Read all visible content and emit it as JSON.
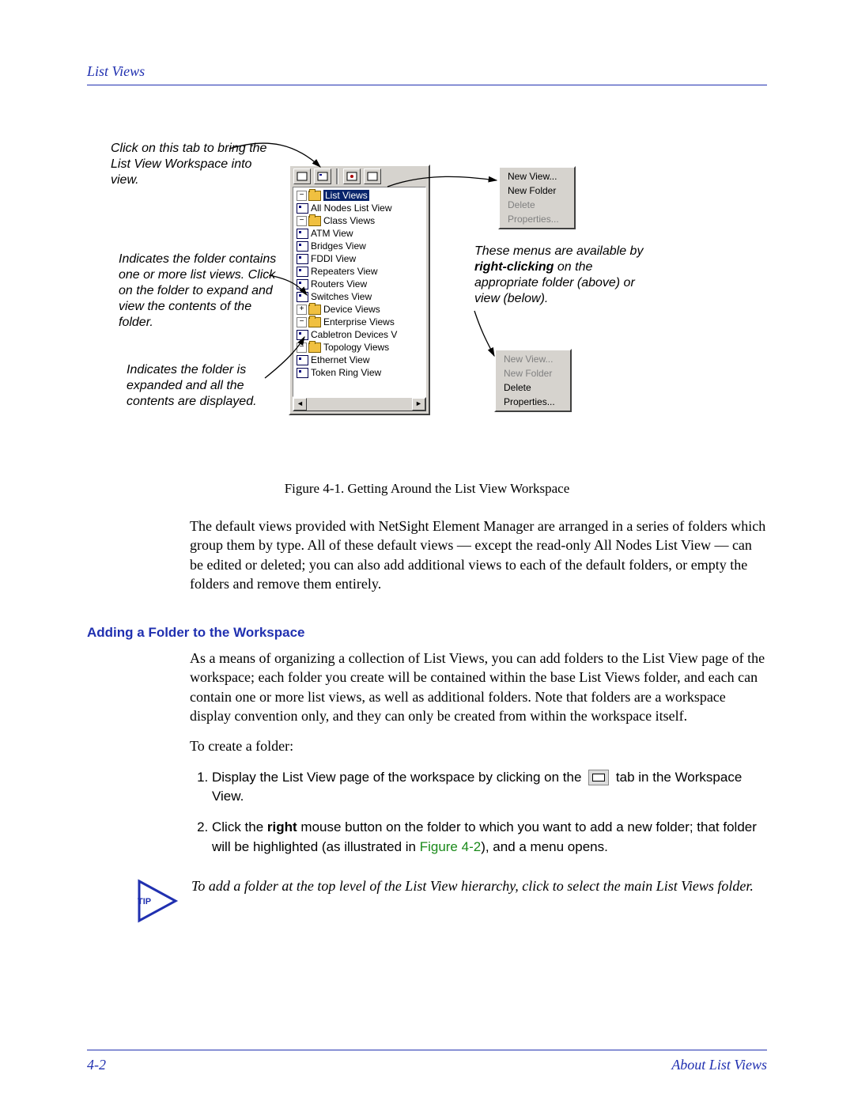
{
  "header": {
    "title": "List Views"
  },
  "callouts": {
    "tab": "Click on this tab to bring the List View Workspace into view.",
    "folder": "Indicates the folder contains one or more list views. Click on the folder to expand and view the contents of the folder.",
    "expanded": "Indicates the folder is expanded and all the contents are displayed.",
    "menus_pre": "These menus are available by ",
    "menus_bold": "right-clicking",
    "menus_post": " on the appropriate folder (above) or view (below)."
  },
  "tree": {
    "root": "List Views",
    "items": [
      "All Nodes List View",
      "Class Views",
      "ATM View",
      "Bridges View",
      "FDDI View",
      "Repeaters View",
      "Routers View",
      "Switches View",
      "Device Views",
      "Enterprise Views",
      "Cabletron Devices V",
      "Topology Views",
      "Ethernet View",
      "Token Ring View"
    ]
  },
  "context_menu_top": {
    "items": [
      "New View...",
      "New Folder",
      "Delete",
      "Properties..."
    ],
    "disabled": [
      false,
      false,
      true,
      true
    ]
  },
  "context_menu_bottom": {
    "items": [
      "New View...",
      "New Folder",
      "Delete",
      "Properties..."
    ],
    "disabled": [
      true,
      true,
      false,
      false
    ]
  },
  "figure_caption": "Figure 4-1. Getting Around the List View Workspace",
  "para1": "The default views provided with NetSight Element Manager are arranged in a series of folders which group them by type. All of these default views — except the read-only All Nodes List View — can be edited or deleted; you can also add additional views to each of the default folders, or empty the folders and remove them entirely.",
  "subsection": "Adding a Folder to the Workspace",
  "para2": "As a means of organizing a collection of List Views, you can add folders to the List View page of the workspace; each folder you create will be contained within the base List Views folder, and each can contain one or more list views, as well as additional folders. Note that folders are a workspace display convention only, and they can only be created from within the workspace itself.",
  "para3": "To create a folder:",
  "steps": {
    "s1a": "Display the List View page of the workspace by clicking on the ",
    "s1b": " tab in the Workspace View.",
    "s2a": "Click the ",
    "s2bold": "right",
    "s2b": " mouse button on the folder to which you want to add a new folder; that folder will be highlighted (as illustrated in ",
    "s2ref": "Figure 4-2",
    "s2c": "), and a menu opens."
  },
  "tip": {
    "label": "TIP",
    "text": "To add a folder at the top level of the List View hierarchy, click to select the main List Views folder."
  },
  "footer": {
    "page": "4-2",
    "section": "About List Views"
  }
}
